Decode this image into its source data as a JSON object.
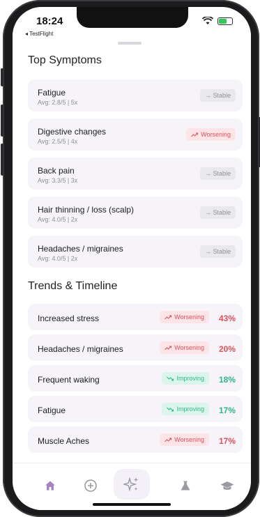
{
  "status": {
    "time": "18:24",
    "back_app": "◂ TestFlight"
  },
  "top_symptoms": {
    "title": "Top Symptoms",
    "items": [
      {
        "name": "Fatigue",
        "meta": "Avg: 2.8/5 | 5x",
        "trend": "→ Stable",
        "kind": "stable"
      },
      {
        "name": "Digestive changes",
        "meta": "Avg: 2.5/5 | 4x",
        "trend": "Worsening",
        "kind": "worse"
      },
      {
        "name": "Back pain",
        "meta": "Avg: 3.3/5 | 3x",
        "trend": "→ Stable",
        "kind": "stable"
      },
      {
        "name": "Hair thinning / loss (scalp)",
        "meta": "Avg: 4.0/5 | 2x",
        "trend": "→ Stable",
        "kind": "stable"
      },
      {
        "name": "Headaches / migraines",
        "meta": "Avg: 4.0/5 | 2x",
        "trend": "→ Stable",
        "kind": "stable"
      }
    ]
  },
  "trends": {
    "title": "Trends & Timeline",
    "items": [
      {
        "name": "Increased stress",
        "trend": "Worsening",
        "kind": "worse",
        "pct": "43%"
      },
      {
        "name": "Headaches / migraines",
        "trend": "Worsening",
        "kind": "worse",
        "pct": "20%"
      },
      {
        "name": "Frequent waking",
        "trend": "Improving",
        "kind": "improve",
        "pct": "18%"
      },
      {
        "name": "Fatigue",
        "trend": "Improving",
        "kind": "improve",
        "pct": "17%"
      },
      {
        "name": "Muscle Aches",
        "trend": "Worsening",
        "kind": "worse",
        "pct": "17%"
      }
    ]
  },
  "tabbar": {
    "active_color": "#a586c4",
    "inactive_color": "#9a9aa0",
    "icons": [
      "home-icon",
      "add-circle-icon",
      "sparkles-icon",
      "flask-icon",
      "graduation-cap-icon"
    ]
  }
}
